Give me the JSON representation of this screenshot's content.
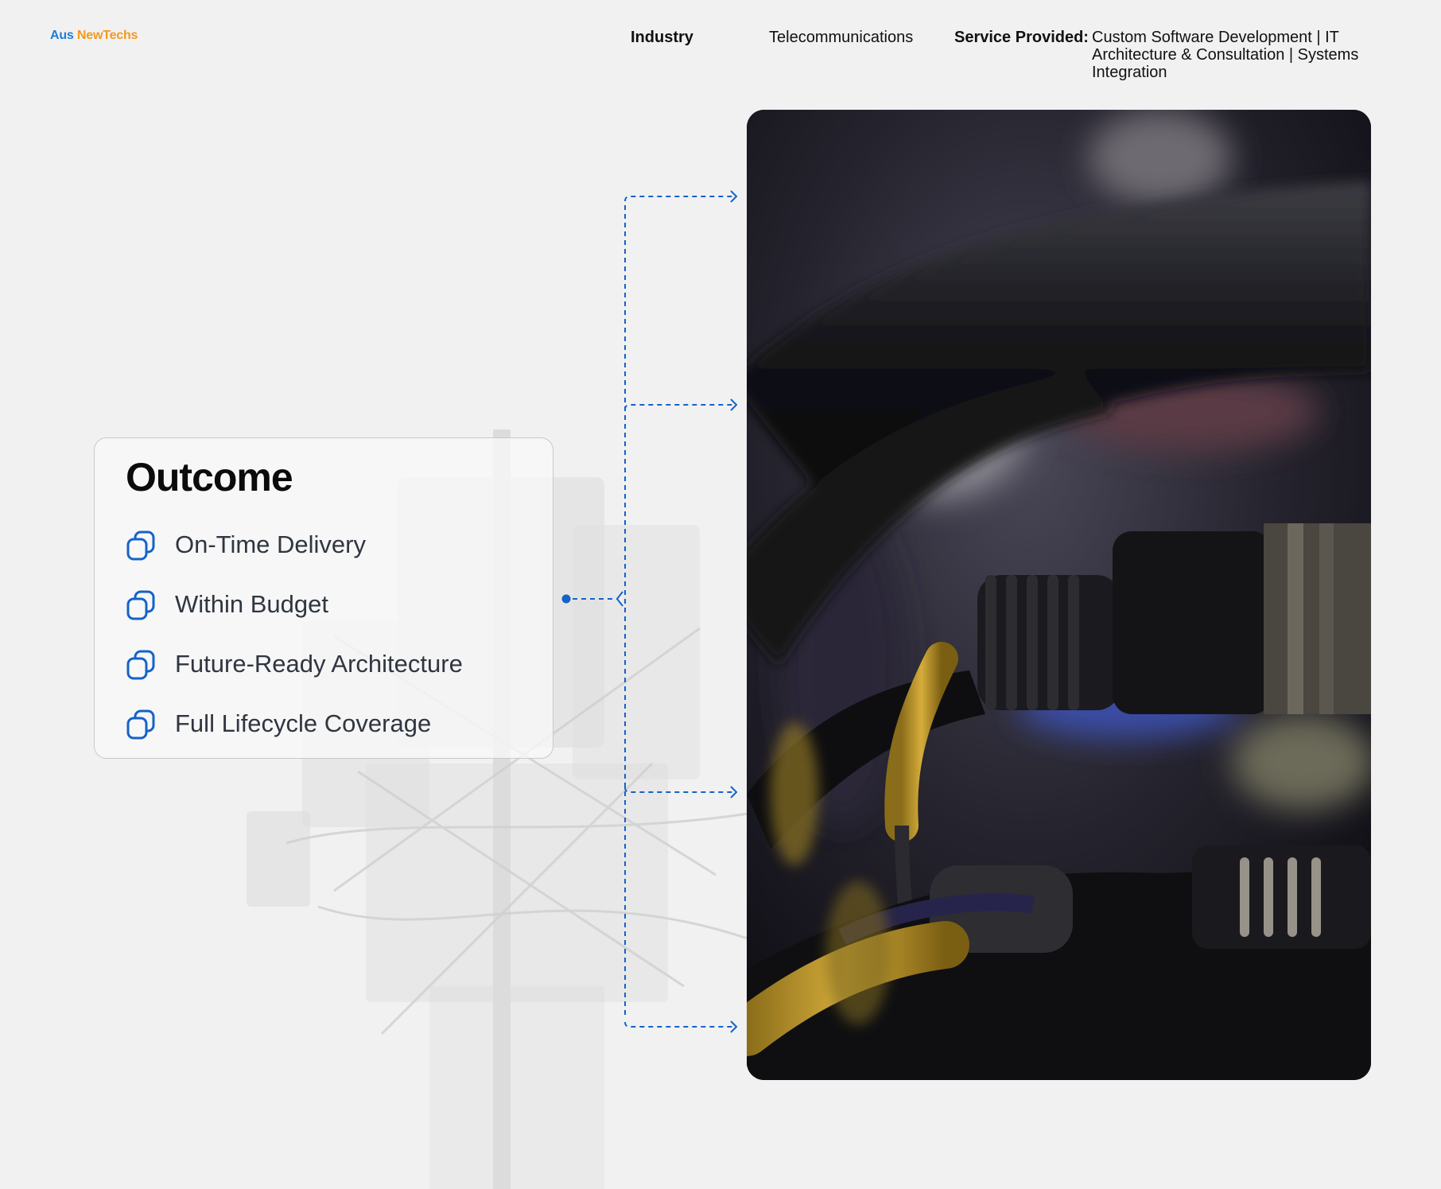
{
  "brand": {
    "part1": "Aus",
    "part2": "NewTechs"
  },
  "header": {
    "industry_label": "Industry",
    "industry_value": "Telecommunications",
    "service_label": "Service Provided:",
    "service_value": "Custom Software Development | IT Architecture & Consultation | Systems Integration"
  },
  "outcome": {
    "title": "Outcome",
    "items": [
      {
        "label": "On-Time Delivery",
        "icon": "overlapping-squares-icon"
      },
      {
        "label": "Within Budget",
        "icon": "overlapping-squares-icon"
      },
      {
        "label": "Future-Ready Architecture",
        "icon": "overlapping-squares-icon"
      },
      {
        "label": "Full Lifecycle Coverage",
        "icon": "overlapping-squares-icon"
      }
    ]
  },
  "colors": {
    "accent_blue": "#1463c8",
    "logo_blue": "#1e7fd6",
    "logo_orange": "#f29a1f",
    "background": "#f1f1f1"
  }
}
